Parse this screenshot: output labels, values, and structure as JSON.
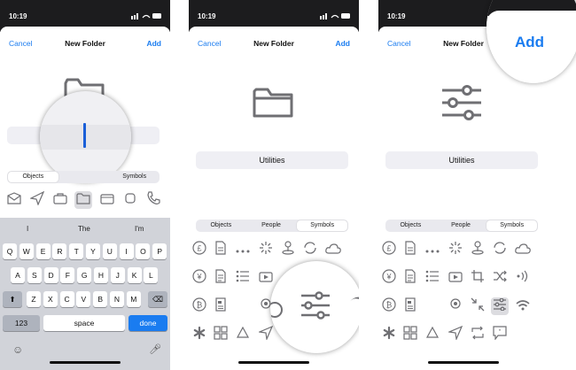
{
  "status": {
    "time": "10:19",
    "icons": "▮▮ ◠ ▬"
  },
  "nav": {
    "cancel": "Cancel",
    "title": "New Folder",
    "add": "Add"
  },
  "panel1": {
    "field_value": "",
    "segments": [
      "Objects",
      "Symbols"
    ],
    "suggestions": [
      "I",
      "The",
      "I'm"
    ],
    "keys_row1": [
      "Q",
      "W",
      "E",
      "R",
      "T",
      "Y",
      "U",
      "I",
      "O",
      "P"
    ],
    "keys_row2": [
      "A",
      "S",
      "D",
      "F",
      "G",
      "H",
      "J",
      "K",
      "L"
    ],
    "keys_row3": [
      "Z",
      "X",
      "C",
      "V",
      "B",
      "N",
      "M"
    ],
    "key_123": "123",
    "key_space": "space",
    "key_done": "done"
  },
  "panel2": {
    "field_value": "Utilities",
    "segments": [
      "Objects",
      "People",
      "Symbols"
    ]
  },
  "panel3": {
    "field_value": "Utilities",
    "segments": [
      "Objects",
      "People",
      "Symbols"
    ],
    "add_magnified": "Add"
  },
  "symbols": {
    "row1": [
      "£",
      "📄",
      "•••",
      "✳",
      "⚲",
      "⟳",
      "☁"
    ],
    "row2": [
      "¥",
      "📄",
      "☰",
      "▶",
      "⌗",
      "⇄",
      "))"
    ],
    "row3": [
      "₿",
      "▣",
      "◎",
      "↙",
      "☰",
      "≋"
    ],
    "row4": [
      "✻",
      "⊞",
      "♻",
      "➤",
      "⟲",
      "❞"
    ]
  }
}
